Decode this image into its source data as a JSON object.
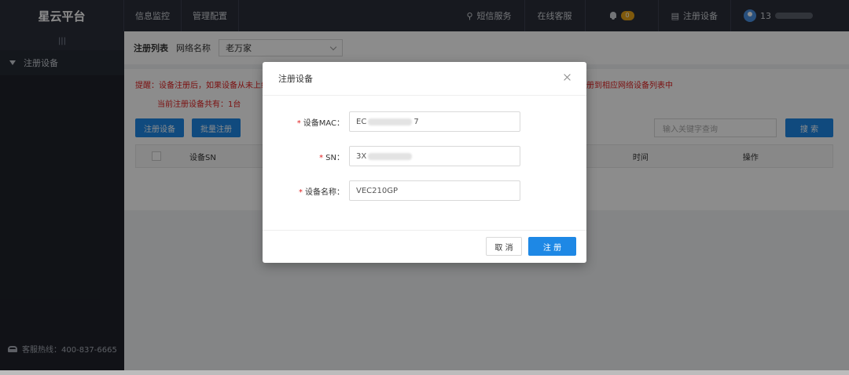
{
  "app": {
    "logo": "星云平台"
  },
  "topnav": [
    {
      "label": "信息监控"
    },
    {
      "label": "管理配置"
    }
  ],
  "topright": {
    "sms": "短信服务",
    "support": "在线客服",
    "notif_count": "0",
    "register_device": "注册设备",
    "user": "13"
  },
  "sidebar": {
    "collapse_icon": "|||",
    "items": [
      {
        "label": "注册设备"
      }
    ],
    "hotline": "客服热线：400-837-6665"
  },
  "filter": {
    "title": "注册列表",
    "network_label": "网络名称",
    "network_value": "老万家"
  },
  "content": {
    "notice": "提醒：设备注册后，如果设备从未上线",
    "notice_right": "注册到相应网络设备列表中",
    "count": "当前注册设备共有：1台",
    "register_btn": "注册设备",
    "batch_btn": "批量注册",
    "search_placeholder": "输入关键字查询",
    "search_btn": "搜 索",
    "columns": {
      "sn": "设备SN",
      "time": "时间",
      "action": "操作"
    }
  },
  "modal": {
    "title": "注册设备",
    "fields": {
      "mac": {
        "label": "设备MAC：",
        "prefix": "EC",
        "suffix": "7"
      },
      "sn": {
        "label": "SN：",
        "prefix": "3X"
      },
      "name": {
        "label": "设备名称：",
        "value": "VEC210GP"
      }
    },
    "required_mark": "*",
    "cancel": "取 消",
    "submit": "注 册"
  },
  "colors": {
    "accent": "#1e88e5",
    "warning": "#e02020",
    "topbar": "#2b2f3a",
    "sidebar": "#1f222a"
  }
}
